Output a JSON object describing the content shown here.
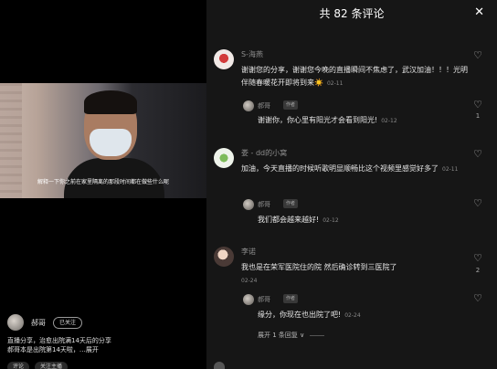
{
  "video": {
    "subtitle": "解释一下你之前在家里隔离的那段时间都在做些什么呢"
  },
  "streamer": {
    "name": "郝哥",
    "follow_label": "已关注",
    "description_line1": "直播分享，治愈出院满14天后的分享",
    "description_line2": "郝哥本是出院第14天啦，…展开",
    "chips": [
      "评论",
      "关注主播"
    ]
  },
  "panel": {
    "title": "共 82 条评论",
    "close_icon": "close-icon",
    "expand_label": "展开 1 条回复 ∨",
    "comments": [
      {
        "user": "S-海燕",
        "text": "谢谢您的分享，谢谢您今晚的直播瞬间不焦虑了，武汉加油！！！光明伴随春暖花开即将到来",
        "emoji": "☀️",
        "date": "02-11",
        "likes": "",
        "reply": {
          "user": "郝哥",
          "tag": "作者",
          "text": "谢谢你，你心里有阳光才会看到阳光!",
          "date": "02-12",
          "likes": "1"
        }
      },
      {
        "user": "娄 - dd的小窝",
        "text": "加油，今天直播的时候听歌明显顺畅比这个视频里感觉好多了",
        "date": "02-11",
        "likes": "",
        "reply": {
          "user": "郝哥",
          "tag": "作者",
          "text": "我们都会越来越好!",
          "date": "02-12",
          "likes": ""
        }
      },
      {
        "user": "李诺",
        "text": "我也是在荣军医院住的院 然后确诊转到三医院了",
        "date": "02-24",
        "likes": "2",
        "reply": {
          "user": "郝哥",
          "tag": "作者",
          "text": "缘分，你现在也出院了吧!",
          "date": "02-24",
          "likes": ""
        }
      }
    ]
  },
  "colors": {
    "panel_bg": "#161616",
    "page_bg": "#000000",
    "muted_text": "#8f8f8f"
  }
}
